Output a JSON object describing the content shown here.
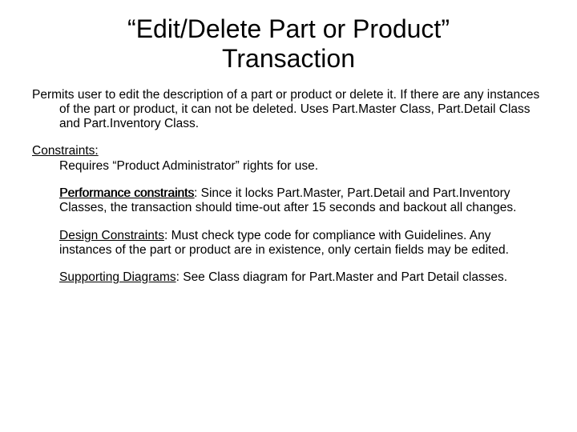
{
  "title_line1": "“Edit/Delete Part or Product”",
  "title_line2": "Transaction",
  "intro": "Permits user to edit the description of a part or product or delete it.  If there are any instances of the part or product, it can not be deleted. Uses Part.Master Class, Part.Detail Class and Part.Inventory Class.",
  "constraints_label": "Constraints:",
  "constraints_text": "Requires “Product Administrator” rights for use.",
  "performance_label": "Performance constraints",
  "performance_colon": ":",
  "performance_text": " Since it locks Part.Master, Part.Detail and Part.Inventory Classes, the transaction should time-out after 15 seconds and backout all changes.",
  "design_label": "Design Constraints",
  "design_colon": ":",
  "design_text": "  Must check type code for compliance with Guidelines.  Any instances of the part or product are in existence, only certain fields may be edited.",
  "supporting_label": "Supporting Diagrams",
  "supporting_colon": ":",
  "supporting_text": " See Class diagram for Part.Master and Part Detail classes."
}
